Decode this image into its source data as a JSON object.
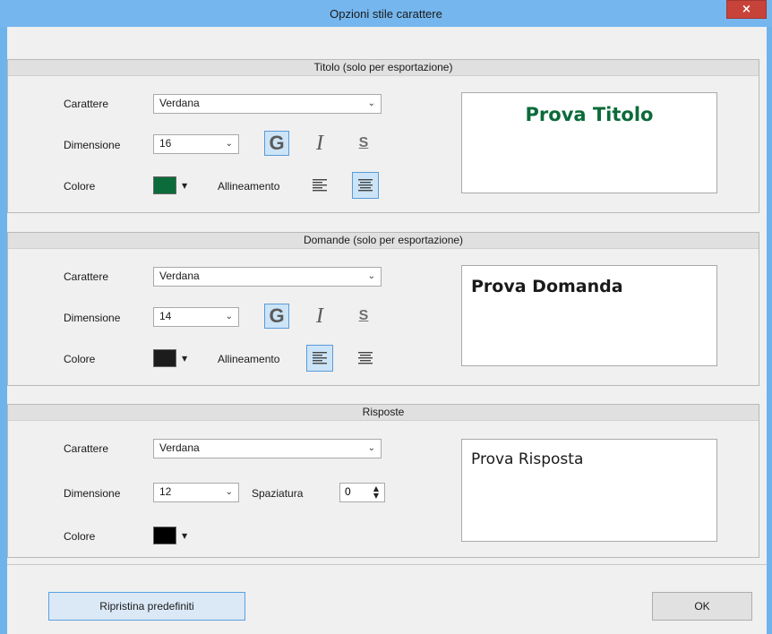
{
  "window": {
    "title": "Opzioni stile carattere",
    "close_symbol": "×"
  },
  "sections": [
    {
      "header": "Titolo (solo per esportazione)",
      "font_label": "Carattere",
      "font_value": "Verdana",
      "size_label": "Dimensione",
      "size_value": "16",
      "color_label": "Colore",
      "color_value": "#0b6b3a",
      "bold_label": "G",
      "italic_label": "I",
      "underline_label": "S",
      "bold_active": true,
      "align_label": "Allineamento",
      "align_active": "center",
      "preview_text": "Prova Titolo"
    },
    {
      "header": "Domande (solo per esportazione)",
      "font_label": "Carattere",
      "font_value": "Verdana",
      "size_label": "Dimensione",
      "size_value": "14",
      "color_label": "Colore",
      "color_value": "#1c1c1c",
      "bold_label": "G",
      "italic_label": "I",
      "underline_label": "S",
      "bold_active": true,
      "align_label": "Allineamento",
      "align_active": "left",
      "preview_text": "Prova Domanda"
    },
    {
      "header": "Risposte",
      "font_label": "Carattere",
      "font_value": "Verdana",
      "size_label": "Dimensione",
      "size_value": "12",
      "spacing_label": "Spaziatura",
      "spacing_value": "0",
      "color_label": "Colore",
      "color_value": "#000000",
      "preview_text": "Prova Risposta"
    }
  ],
  "footer": {
    "reset_label": "Ripristina predefiniti",
    "ok_label": "OK"
  },
  "icons": {
    "dropdown": "chevron-down-icon",
    "color_dropdown": "caret-down-icon",
    "align_left": "align-left-icon",
    "align_center": "align-center-icon",
    "spin_up": "spin-up-icon",
    "spin_down": "spin-down-icon"
  }
}
